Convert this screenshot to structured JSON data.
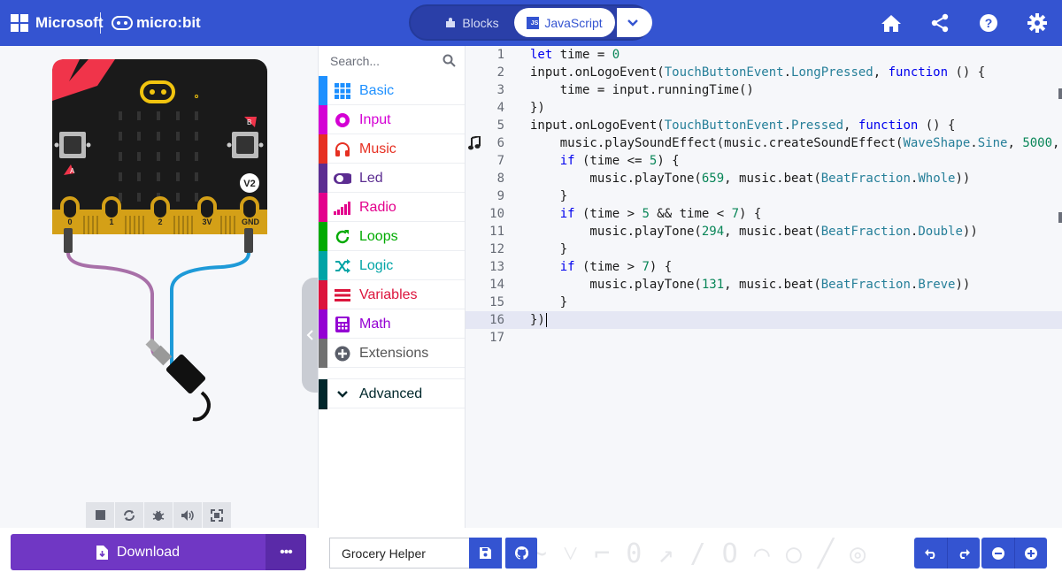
{
  "header": {
    "brand": "Microsoft",
    "product": "micro:bit",
    "blocks_label": "Blocks",
    "js_label": "JavaScript",
    "js_badge": "JS",
    "icons": [
      "home-icon",
      "share-icon",
      "help-icon",
      "gear-icon"
    ],
    "accent": "#3454d1"
  },
  "simulator": {
    "pins": [
      "0",
      "1",
      "2",
      "3V",
      "GND"
    ],
    "button_a": "A",
    "button_b": "B",
    "version_badge": "V2",
    "toolbar_icons": [
      "stop-icon",
      "restart-icon",
      "debug-icon",
      "sound-icon",
      "fullscreen-icon"
    ]
  },
  "toolbox": {
    "search_placeholder": "Search...",
    "categories": [
      {
        "label": "Basic",
        "color": "#1e90ff",
        "icon": "grid-icon"
      },
      {
        "label": "Input",
        "color": "#d400d4",
        "icon": "radio-button-icon"
      },
      {
        "label": "Music",
        "color": "#e63022",
        "icon": "headphones-icon"
      },
      {
        "label": "Led",
        "color": "#5c2d91",
        "icon": "toggle-icon"
      },
      {
        "label": "Radio",
        "color": "#e3008c",
        "icon": "signal-icon"
      },
      {
        "label": "Loops",
        "color": "#00aa00",
        "icon": "loop-icon"
      },
      {
        "label": "Logic",
        "color": "#00a4a6",
        "icon": "shuffle-icon"
      },
      {
        "label": "Variables",
        "color": "#dc143c",
        "icon": "list-icon"
      },
      {
        "label": "Math",
        "color": "#9400d3",
        "icon": "calculator-icon"
      },
      {
        "label": "Extensions",
        "color": "#717171",
        "icon": "plus-circle-icon"
      }
    ],
    "advanced": {
      "label": "Advanced",
      "color": "#00272b"
    }
  },
  "editor": {
    "line_numbers": [
      "1",
      "2",
      "3",
      "4",
      "5",
      "6",
      "7",
      "8",
      "9",
      "10",
      "11",
      "12",
      "13",
      "14",
      "15",
      "16",
      "17"
    ],
    "highlighted_line": 16,
    "gutter_icon_line": 6
  },
  "bottom": {
    "download_label": "Download",
    "more_label": "•••",
    "project_name": "Grocery Helper",
    "icons": [
      "save-icon",
      "github-icon",
      "undo-icon",
      "redo-icon",
      "zoom-out-icon",
      "zoom-in-icon"
    ]
  }
}
